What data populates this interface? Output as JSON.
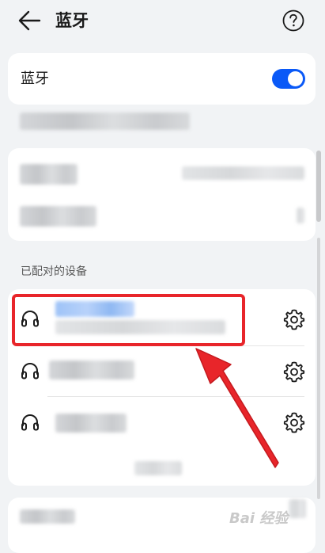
{
  "header": {
    "title": "蓝牙",
    "back_icon": "back-arrow-icon",
    "help_icon": "help-icon"
  },
  "bluetooth": {
    "label": "蓝牙",
    "enabled": true,
    "accent": "#0a59f7"
  },
  "paired_section": {
    "title": "已配对的设备"
  },
  "paired_devices": [
    {
      "icon": "headset-icon",
      "action_icon": "gear-icon"
    },
    {
      "icon": "headset-icon",
      "action_icon": "gear-icon"
    },
    {
      "icon": "headset-icon",
      "action_icon": "gear-icon"
    }
  ],
  "annotation": {
    "highlight_color": "#e8252a"
  },
  "watermark": {
    "text": "Bai 经验"
  }
}
